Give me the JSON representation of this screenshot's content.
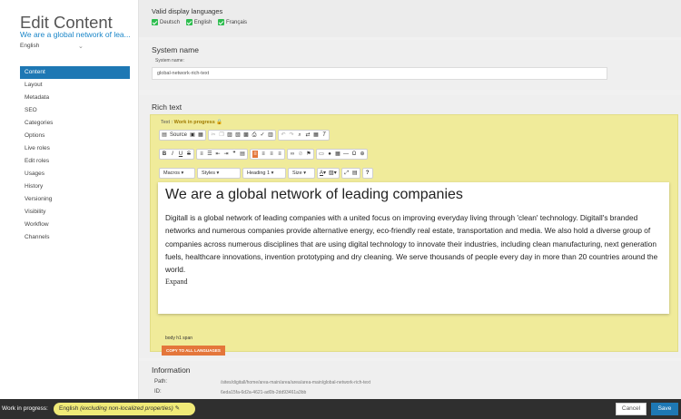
{
  "sidebar": {
    "title": "Edit Content",
    "subtitle": "We are a global network of lea...",
    "language": "English",
    "items": [
      {
        "label": "Content"
      },
      {
        "label": "Layout"
      },
      {
        "label": "Metadata"
      },
      {
        "label": "SEO"
      },
      {
        "label": "Categories"
      },
      {
        "label": "Options"
      },
      {
        "label": "Live roles"
      },
      {
        "label": "Edit roles"
      },
      {
        "label": "Usages"
      },
      {
        "label": "History"
      },
      {
        "label": "Versioning"
      },
      {
        "label": "Visibility"
      },
      {
        "label": "Workflow"
      },
      {
        "label": "Channels"
      }
    ],
    "active_item": "Content"
  },
  "languages": {
    "heading": "Valid display languages",
    "options": [
      "Deutsch",
      "English",
      "Français"
    ]
  },
  "system_name": {
    "heading": "System name",
    "field_label": "System name:",
    "value": "global-network-rich-text"
  },
  "rich_text": {
    "heading": "Rich text",
    "status_prefix": "Text : ",
    "status": "Work in progress",
    "toolbar": {
      "source_label": "Source",
      "row3": {
        "format": "Macros",
        "styles": "Styles",
        "heading": "Heading 1",
        "size": "Size"
      }
    },
    "document": {
      "heading": "We are a global network of leading companies",
      "body": "Digitall is a global network of leading companies with a united focus on improving everyday living through 'clean' technology. Digitall's branded networks and numerous companies provide alternative energy, eco-friendly real estate, transportation and media. We also hold a diverse group of companies across numerous disciplines that are using digital technology to innovate their industries, including clean manufacturing, next generation fuels, healthcare innovations, invention prototyping and dry cleaning. We serve thousands of people every day in more than 20 countries around the world.",
      "expand": "Expand"
    },
    "element_path": "body   h1   span",
    "copy_button": "COPY TO ALL LANGUAGES"
  },
  "information": {
    "heading": "Information",
    "path_label": "Path:",
    "path_value": "/sites/digitall/home/area-main/area/area/area-main/global-network-rich-text",
    "id_label": "ID:",
    "id_value": "6eda15fa-6d2a-4621-ad0b-2dd93461a3bb"
  },
  "footer": {
    "label": "Work in progress:",
    "pill": "English",
    "pill_note": "(excluding non-localized properties)",
    "cancel": "Cancel",
    "save": "Save"
  },
  "colors": {
    "accent": "#1e78b4",
    "editor_bg": "#f0eb9a",
    "orange": "#e4763b",
    "check": "#2dbd4e"
  }
}
